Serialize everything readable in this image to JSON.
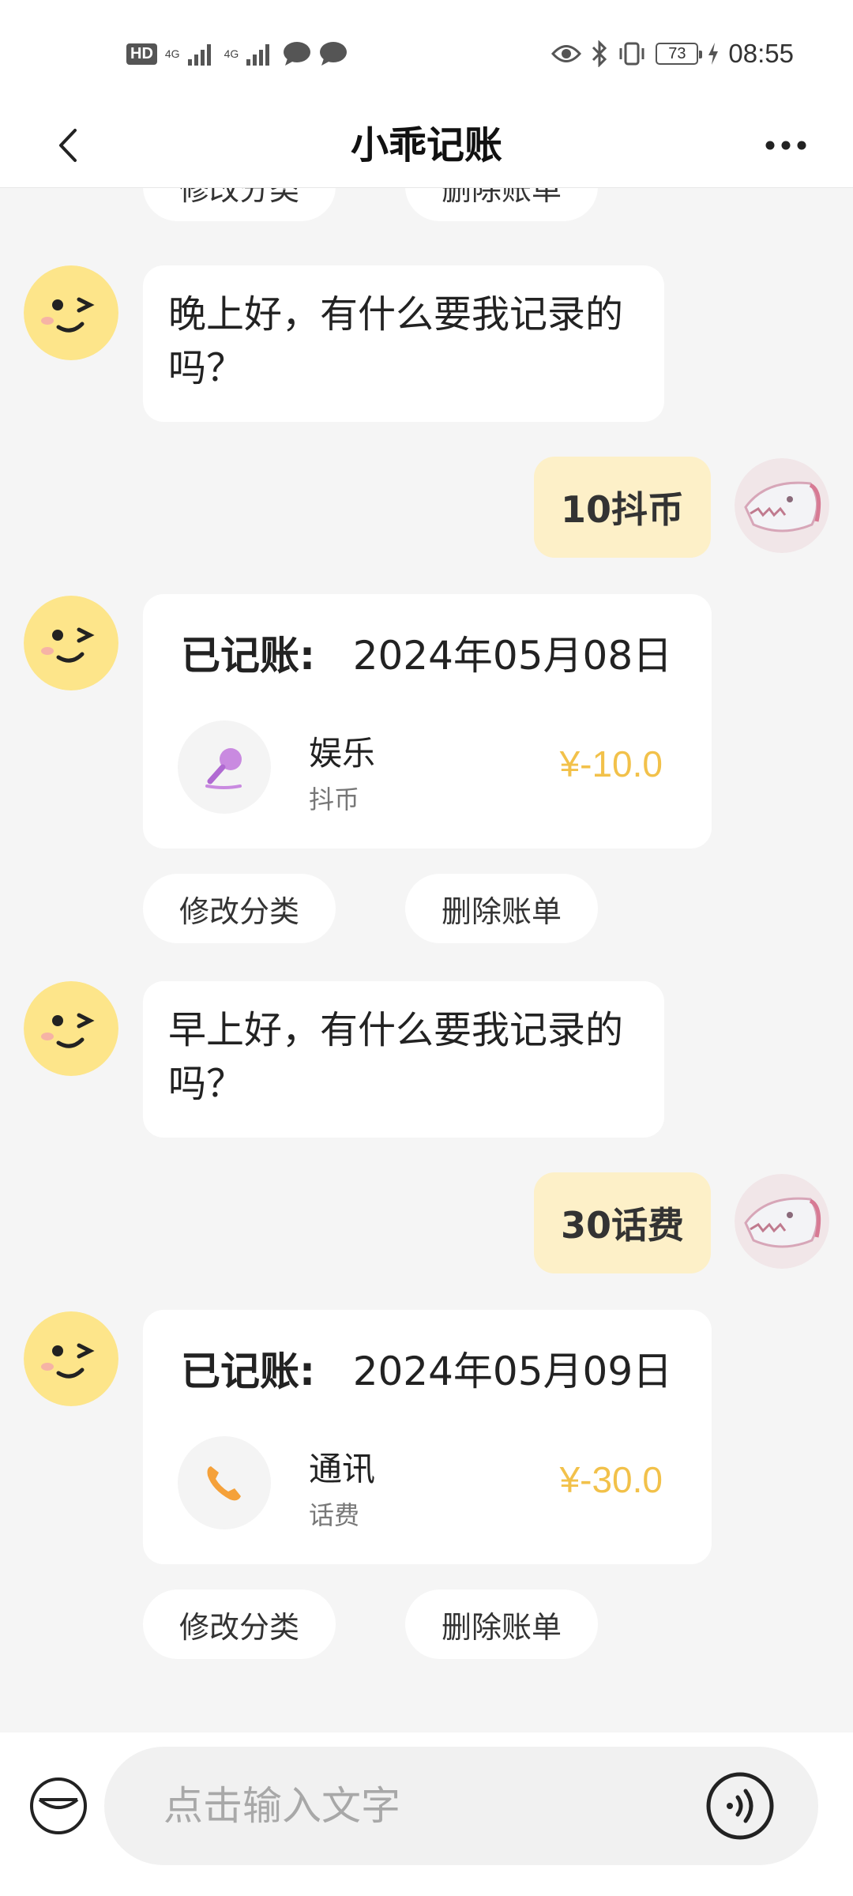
{
  "status_bar": {
    "hd": "HD",
    "net1": "4G",
    "net2": "4G",
    "battery": "73",
    "time": "08:55"
  },
  "header": {
    "title": "小乖记账"
  },
  "chat": {
    "top_partial_actions": {
      "edit": "修改分类",
      "delete": "删除账单"
    },
    "greeting_evening": "晚上好，有什么要我记录的吗？",
    "user_msg_1": "10抖币",
    "record_1": {
      "label": "已记账:",
      "date": "2024年05月08日",
      "category": "娱乐",
      "note": "抖币",
      "amount": "¥-10.0",
      "icon": "microphone-icon"
    },
    "record_1_actions": {
      "edit": "修改分类",
      "delete": "删除账单"
    },
    "greeting_morning": "早上好，有什么要我记录的吗？",
    "user_msg_2": "30话费",
    "record_2": {
      "label": "已记账:",
      "date": "2024年05月09日",
      "category": "通讯",
      "note": "话费",
      "amount": "¥-30.0",
      "icon": "phone-icon"
    },
    "record_2_actions": {
      "edit": "修改分类",
      "delete": "删除账单"
    }
  },
  "input_bar": {
    "placeholder": "点击输入文字"
  },
  "colors": {
    "user_bubble": "#fdf0c8",
    "amount": "#f2c14a",
    "background": "#f5f5f5"
  }
}
